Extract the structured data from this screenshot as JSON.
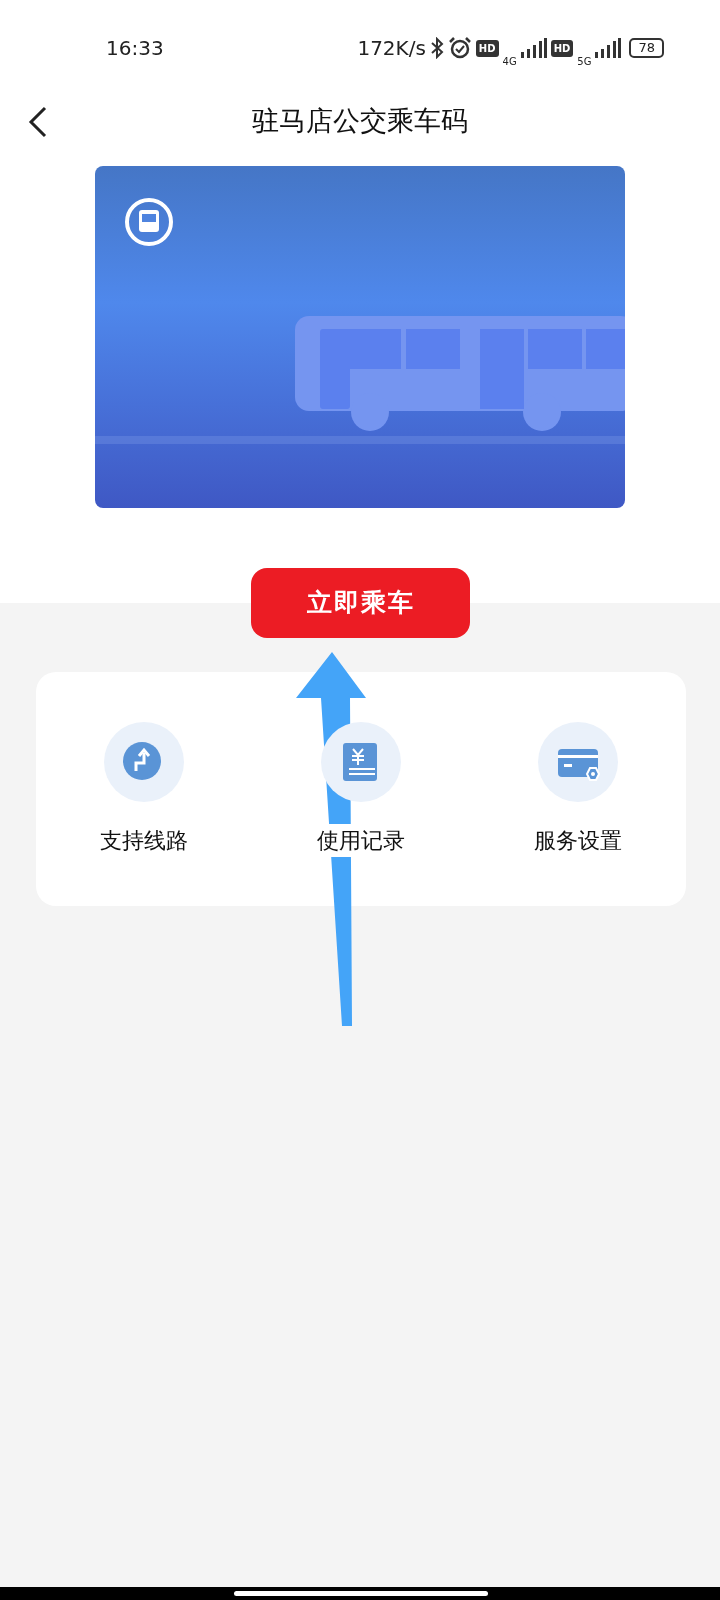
{
  "status_bar": {
    "time": "16:33",
    "speed": "172K/s",
    "sim1": {
      "badge": "HD",
      "network": "4G"
    },
    "sim2": {
      "badge": "HD",
      "network": "5G"
    },
    "battery": "78"
  },
  "header": {
    "title": "驻马店公交乘车码"
  },
  "ride_button": {
    "label": "立即乘车"
  },
  "services": [
    {
      "kind": "route",
      "label": "支持线路"
    },
    {
      "kind": "records",
      "label": "使用记录"
    },
    {
      "kind": "settings",
      "label": "服务设置"
    }
  ]
}
